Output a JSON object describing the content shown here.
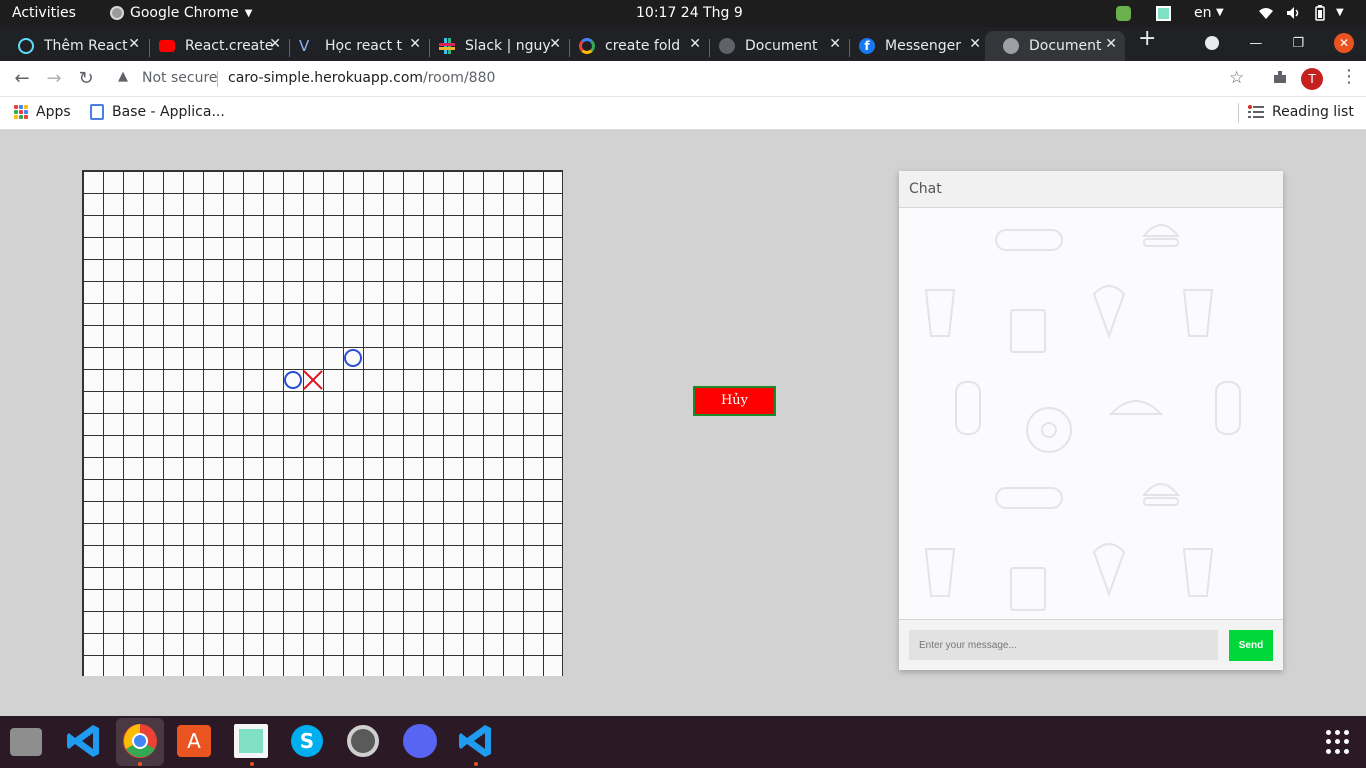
{
  "topbar": {
    "activities": "Activities",
    "app_name": "Google Chrome",
    "clock": "10:17  24 Thg 9",
    "language": "en"
  },
  "tabs": [
    {
      "label": "Thêm React",
      "favicon": "react-icon",
      "color": "#61dafb",
      "active": false
    },
    {
      "label": "React.create",
      "favicon": "youtube-icon",
      "color": "#ff0000",
      "active": false
    },
    {
      "label": "Học react t",
      "favicon": "vuetify-icon",
      "color": "#4a7fe0",
      "active": false
    },
    {
      "label": "Slack | nguy",
      "favicon": "slack-icon",
      "color": "#e01e5a",
      "active": false
    },
    {
      "label": "create fold",
      "favicon": "google-icon",
      "color": "#4285f4",
      "active": false
    },
    {
      "label": "Document",
      "favicon": "globe-icon",
      "color": "#5f6368",
      "active": false
    },
    {
      "label": "Messenger",
      "favicon": "facebook-icon",
      "color": "#1877f2",
      "active": false
    },
    {
      "label": "Document",
      "favicon": "globe-icon",
      "color": "#9aa0a6",
      "active": true
    }
  ],
  "toolbar": {
    "security_label": "Not secure",
    "url_host": "caro-simple.herokuapp.com",
    "url_path": "/room/880",
    "profile_initial": "T"
  },
  "bookmarks": {
    "apps": "Apps",
    "base": "Base - Applica...",
    "reading_list": "Reading list"
  },
  "game": {
    "board_cols": 24,
    "board_rows": 23,
    "moves": [
      {
        "mark": "O",
        "col": 13,
        "row": 8
      },
      {
        "mark": "O",
        "col": 10,
        "row": 9
      },
      {
        "mark": "X",
        "col": 11,
        "row": 9
      }
    ],
    "colors": {
      "O": "#2a4fd0",
      "X": "#e0161f"
    },
    "cancel_label": "Hủy"
  },
  "chat": {
    "header": "Chat",
    "input_placeholder": "Enter your message...",
    "send_label": "Send"
  },
  "dock": {
    "apps": [
      "files-icon",
      "vscode-icon",
      "chrome-icon",
      "software-center-icon",
      "notes-icon",
      "skype-icon",
      "settings-icon",
      "discord-icon",
      "vscode-icon"
    ]
  }
}
